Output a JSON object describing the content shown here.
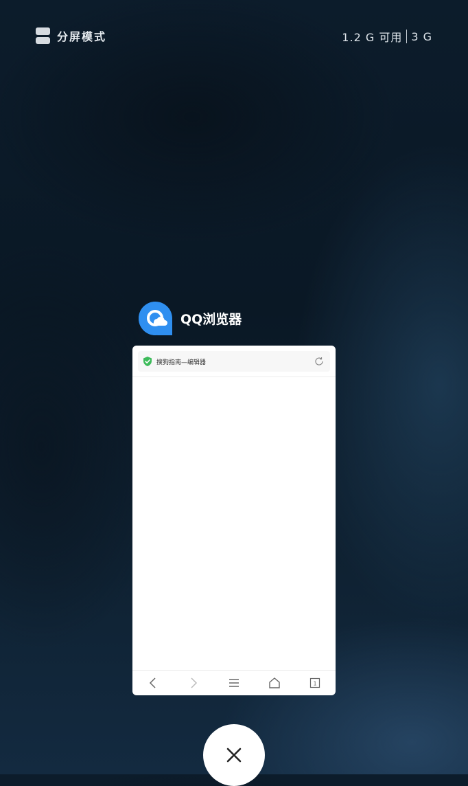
{
  "top_bar": {
    "split_mode_label": "分屏模式",
    "memory_available": "1.2 G 可用",
    "memory_total": "3 G"
  },
  "app": {
    "name": "QQ浏览器",
    "icon": "qq-browser-icon",
    "accent_color": "#2f8ff0"
  },
  "card": {
    "url_title": "搜狗指南—编辑器",
    "bottom_nav": [
      "back-icon",
      "forward-icon",
      "menu-icon",
      "home-icon",
      "tabs-icon"
    ],
    "tab_count": "1"
  },
  "close_button": {
    "icon": "close-icon"
  }
}
